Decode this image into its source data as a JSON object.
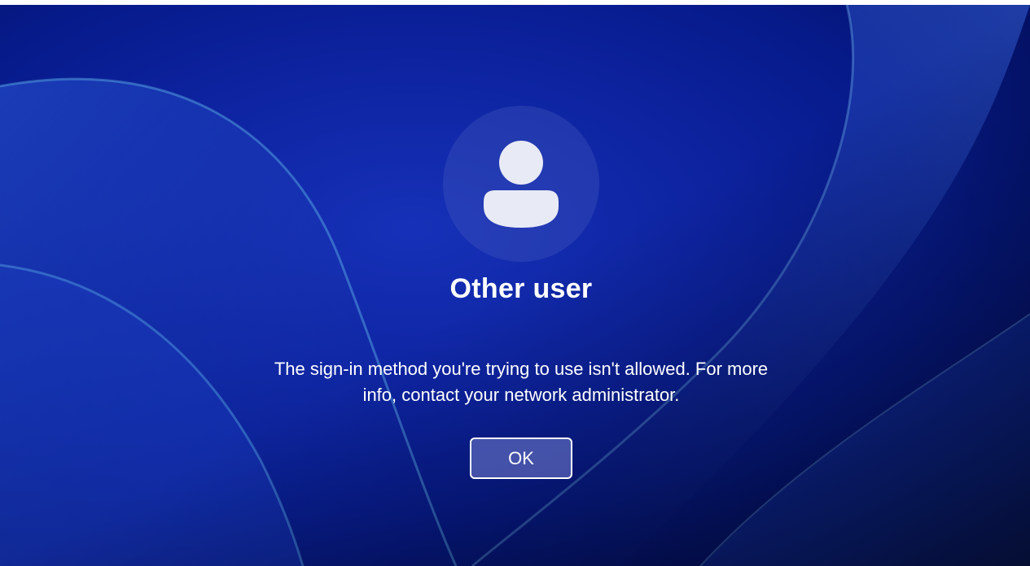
{
  "user": {
    "name": "Other user",
    "avatar_icon": "person-icon"
  },
  "dialog": {
    "message": "The sign-in method you're trying to use isn't allowed. For more info, contact your network administrator.",
    "ok_label": "OK"
  },
  "colors": {
    "background": "#0d23a0",
    "avatar_circle": "#2a3fae",
    "person_glyph": "#e8eaf6"
  }
}
